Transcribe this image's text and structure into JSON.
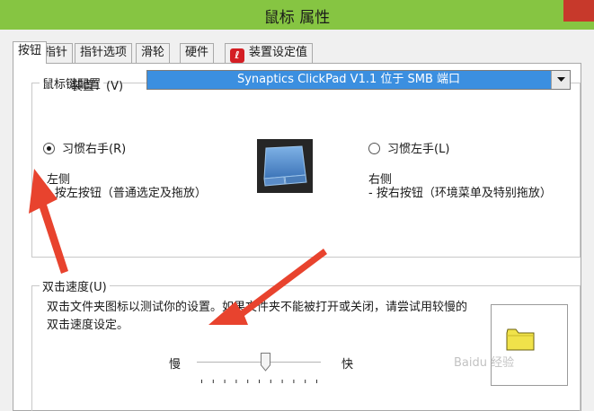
{
  "window": {
    "title": "鼠标 属性"
  },
  "tabs": [
    {
      "label": "按钮",
      "active": true
    },
    {
      "label": "指针",
      "active": false
    },
    {
      "label": "指针选项",
      "active": false
    },
    {
      "label": "滑轮",
      "active": false
    },
    {
      "label": "硬件",
      "active": false
    },
    {
      "label": "装置设定值",
      "active": false,
      "badge": "ℓ"
    }
  ],
  "button_config": {
    "legend": "鼠标键配置",
    "device_label": "装置：(V)",
    "device_value": "Synaptics ClickPad V1.1 位于 SMB 端口",
    "right_handed": {
      "label": "习惯右手(R)",
      "selected": true,
      "side_title": "左侧",
      "side_desc": "- 按左按钮（普通选定及拖放）"
    },
    "left_handed": {
      "label": "习惯左手(L)",
      "selected": false,
      "side_title": "右侧",
      "side_desc": "- 按右按钮（环境菜单及特别拖放）"
    }
  },
  "double_click": {
    "legend": "双击速度(U)",
    "description": "双击文件夹图标以测试你的设置。如果文件夹不能被打开或关闭，请尝试用较慢的双击速度设定。",
    "slow_label": "慢",
    "fast_label": "快",
    "speed_level": 0.55
  },
  "watermark": "Baidu 经验",
  "colors": {
    "titlebar": "#86c542",
    "select_highlight": "#3b8fe0",
    "arrow": "#e8432e",
    "folder": "#f0e24a"
  }
}
